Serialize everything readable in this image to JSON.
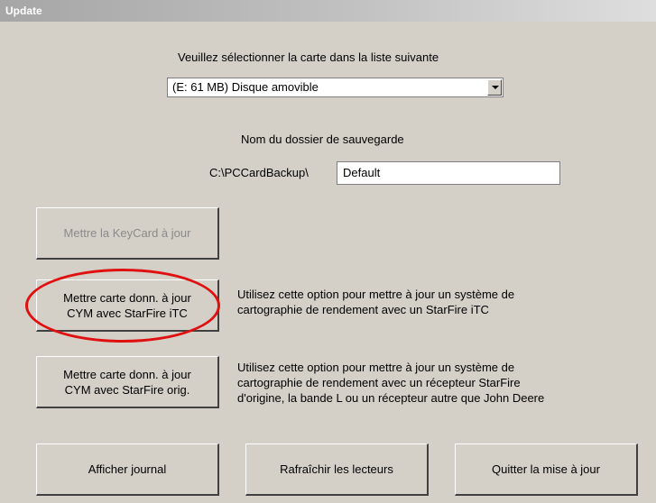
{
  "window": {
    "title": "Update"
  },
  "card_select": {
    "prompt": "Veuillez sélectionner la carte dans la liste suivante",
    "selected": "(E: 61 MB) Disque amovible"
  },
  "backup": {
    "label": "Nom du dossier de sauvegarde",
    "path_prefix": "C:\\PCCardBackup\\",
    "folder_value": "Default"
  },
  "buttons": {
    "keycard": "Mettre la KeyCard à jour",
    "itc_line1": "Mettre carte donn. à jour",
    "itc_line2": "CYM avec StarFire iTC",
    "orig_line1": "Mettre carte donn. à jour",
    "orig_line2": "CYM avec StarFire orig.",
    "journal": "Afficher journal",
    "refresh": "Rafraîchir les lecteurs",
    "quit": "Quitter la mise à jour"
  },
  "descriptions": {
    "itc_line1": "Utilisez cette option pour mettre à jour un système de",
    "itc_line2": "cartographie de rendement avec un StarFire iTC",
    "orig_line1": "Utilisez cette option pour mettre à jour un système de",
    "orig_line2": "cartographie de rendement avec un récepteur StarFire",
    "orig_line3": "d'origine, la bande L ou un récepteur autre que John Deere"
  },
  "colors": {
    "background": "#d4d0c8",
    "annotation_circle": "#e01010"
  }
}
